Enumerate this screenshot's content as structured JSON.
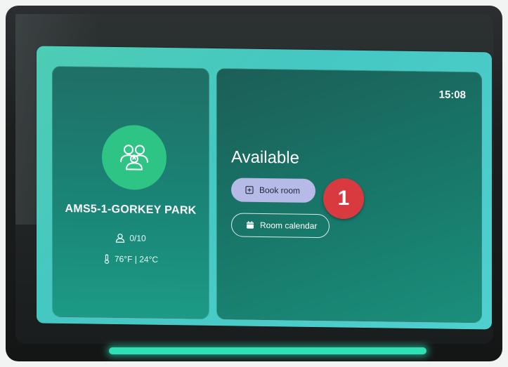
{
  "device": {
    "time": "15:08"
  },
  "room": {
    "name": "AMS5-1-GORKEY PARK",
    "occupancy": "0/10",
    "temperature": "76°F | 24°C",
    "icon": "people-group-icon"
  },
  "status": {
    "label": "Available"
  },
  "actions": {
    "book_room": "Book room",
    "room_calendar": "Room calendar"
  },
  "annotation": {
    "step_number": "1",
    "color": "#d93a3f"
  },
  "colors": {
    "accent_green": "#2ec486",
    "button_lavender": "#b7b9e6",
    "led_green": "#2fe0b7"
  }
}
